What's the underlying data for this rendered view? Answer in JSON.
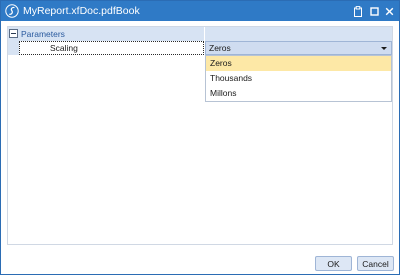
{
  "window": {
    "title": "MyReport.xfDoc.pdfBook",
    "titlebar_color": "#2f7ac6"
  },
  "titlebar_buttons": {
    "pin_icon": "clipboard-icon",
    "maximize_icon": "maximize-icon",
    "close_icon": "close-icon"
  },
  "property_grid": {
    "category": {
      "label": "Parameters",
      "expanded": true
    },
    "property": {
      "name": "Scaling",
      "value": "Zeros"
    },
    "dropdown": {
      "options": [
        "Zeros",
        "Thousands",
        "Millons"
      ],
      "selected": "Zeros",
      "highlight_color": "#fde8a6"
    }
  },
  "footer": {
    "ok_label": "OK",
    "cancel_label": "Cancel"
  }
}
